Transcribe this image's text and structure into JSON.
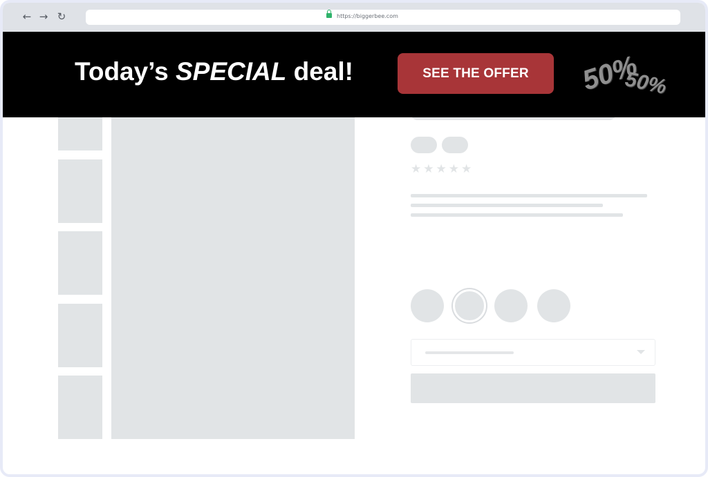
{
  "browser": {
    "url": "https://biggerbee.com",
    "back_icon": "←",
    "forward_icon": "→",
    "reload_icon": "↻"
  },
  "banner": {
    "headline_prefix": "Today’s ",
    "headline_emphasis": "SPECIAL",
    "headline_suffix": " deal!",
    "button_label": "SEE THE OFFER",
    "badge_primary": "50%",
    "badge_secondary": "50%",
    "colors": {
      "background": "#000000",
      "button": "#a83538",
      "text": "#ffffff"
    }
  },
  "product": {
    "stars": "★★★★★"
  }
}
